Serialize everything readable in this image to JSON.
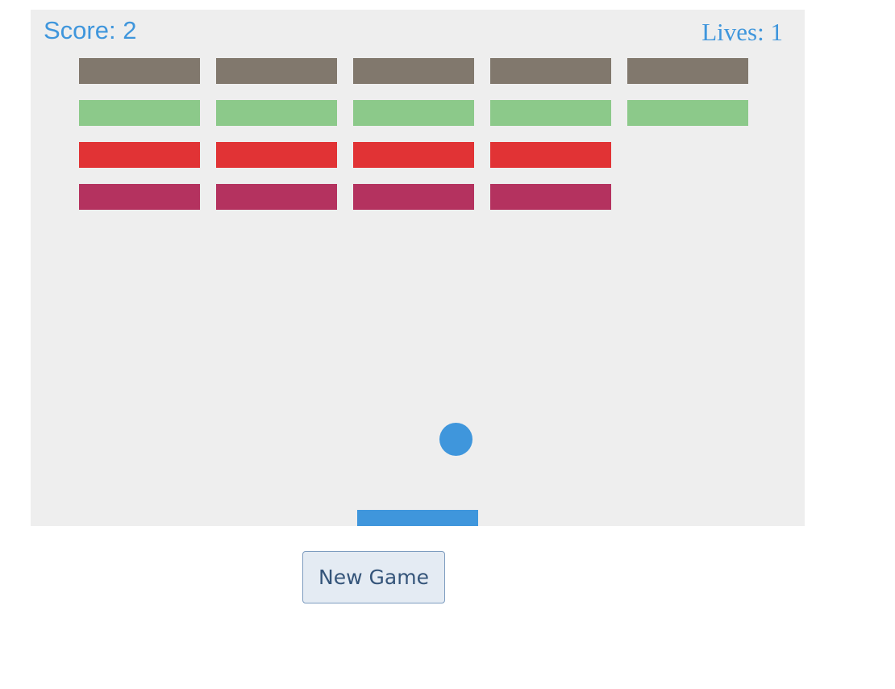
{
  "hud": {
    "score_text": "Score: 2",
    "lives_text": "Lives: 1",
    "score": 2,
    "lives": 1,
    "text_color": "#3f96dc"
  },
  "bricks": {
    "row_colors": [
      "#81786d",
      "#8cc98a",
      "#e13335",
      "#b4325f"
    ],
    "rows": [
      [
        true,
        true,
        true,
        true,
        true
      ],
      [
        true,
        true,
        true,
        true,
        true
      ],
      [
        true,
        true,
        true,
        true,
        false
      ],
      [
        true,
        true,
        true,
        true,
        false
      ]
    ]
  },
  "ball": {
    "color": "#3f96dc"
  },
  "paddle": {
    "color": "#3f96dc"
  },
  "controls": {
    "new_game_label": "New Game"
  }
}
